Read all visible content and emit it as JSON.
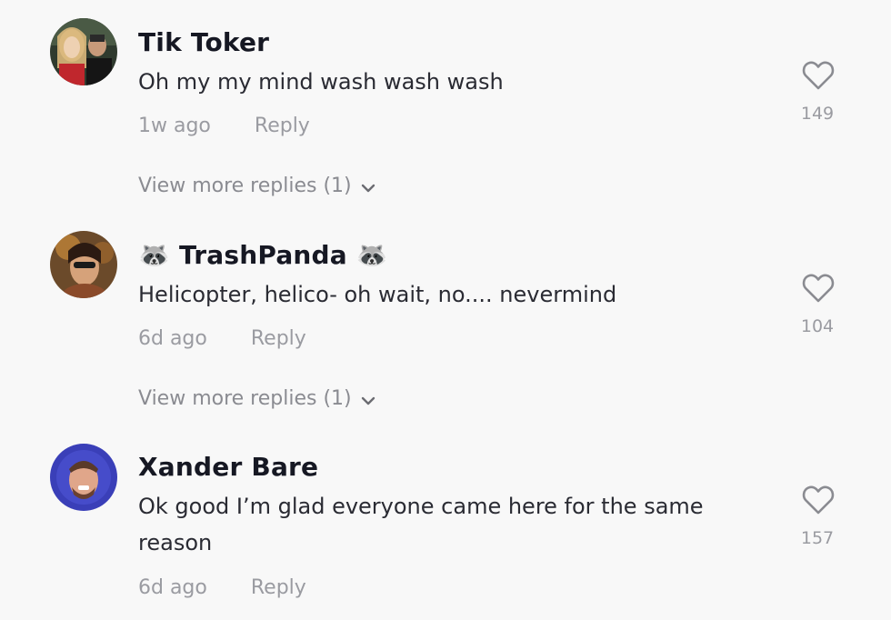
{
  "comments": [
    {
      "username": "Tik Toker",
      "username_prefix_emoji": "",
      "username_suffix_emoji": "",
      "text": "Oh my my mind wash wash wash",
      "time": "1w ago",
      "reply_label": "Reply",
      "likes": "149",
      "view_more": "View more replies (1)"
    },
    {
      "username": "TrashPanda",
      "username_prefix_emoji": "🦝",
      "username_suffix_emoji": "🦝",
      "text": "Helicopter, helico- oh wait, no.... nevermind",
      "time": "6d ago",
      "reply_label": "Reply",
      "likes": "104",
      "view_more": "View more replies (1)"
    },
    {
      "username": "Xander Bare",
      "username_prefix_emoji": "",
      "username_suffix_emoji": "",
      "text": "Ok good I’m glad everyone came here for the same reason",
      "time": "6d ago",
      "reply_label": "Reply",
      "likes": "157",
      "view_more": ""
    }
  ],
  "colors": {
    "background": "#f8f8f8",
    "username": "#161823",
    "text": "#2a2b33",
    "muted": "#9a9ba1"
  }
}
